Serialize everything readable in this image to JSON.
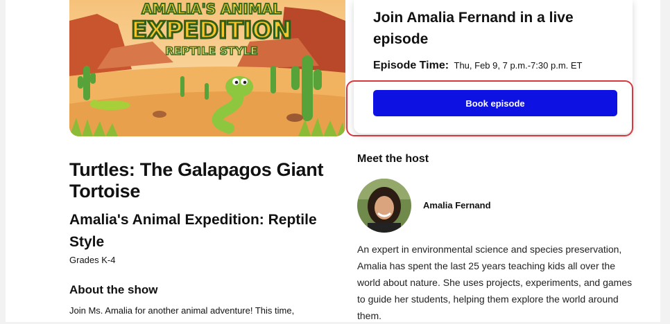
{
  "hero": {
    "art_title_line1": "AMALIA'S ANIMAL",
    "art_title_line2": "EXPEDITION",
    "art_title_line3": "REPTILE STYLE"
  },
  "booking": {
    "title": "Join Amalia Fernand in a live episode",
    "time_label": "Episode Time:",
    "time_value": "Thu, Feb 9, 7 p.m.-7:30 p.m. ET",
    "button_label": "Book episode",
    "accent_color": "#0d12e3",
    "highlight_color": "#d9363e"
  },
  "episode": {
    "title": "Turtles: The Galapagos Giant Tortoise",
    "series": "Amalia's Animal Expedition: Reptile Style",
    "grades": "Grades K-4"
  },
  "about": {
    "heading": "About the show",
    "text": "Join Ms. Amalia for another animal adventure! This time,"
  },
  "host": {
    "heading": "Meet the host",
    "name": "Amalia Fernand",
    "bio": "An expert in environmental science and species preservation, Amalia has spent the last 25 years teaching kids all over the world about nature. She uses projects, experiments, and games to guide her students, helping them explore the world around them."
  }
}
